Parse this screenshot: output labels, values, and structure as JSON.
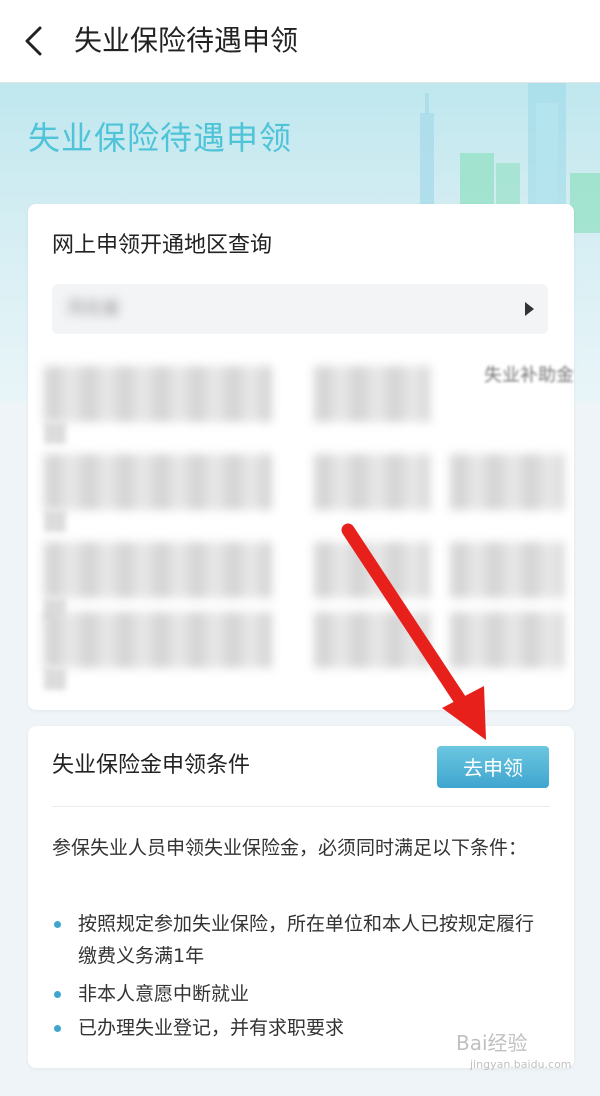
{
  "header": {
    "title": "失业保险待遇申领"
  },
  "hero": {
    "title": "失业保险待遇申领"
  },
  "region_query": {
    "heading": "网上申领开通地区查询",
    "selected_region": "河北省",
    "rows": [
      {
        "col1": "",
        "col2": "",
        "col3": "失业补助金"
      },
      {
        "col1": "",
        "col2": "",
        "col3": ""
      },
      {
        "col1": "",
        "col2": "",
        "col3": ""
      },
      {
        "col1": "",
        "col2": "",
        "col3": ""
      }
    ]
  },
  "conditions": {
    "heading": "失业保险金申领条件",
    "apply_label": "去申领",
    "intro": "参保失业人员申领失业保险金，必须同时满足以下条件：",
    "items": [
      "按照规定参加失业保险，所在单位和本人已按规定履行缴费义务满1年",
      "非本人意愿中断就业",
      "已办理失业登记，并有求职要求"
    ]
  },
  "watermark": {
    "text": "Bai经验",
    "sub": "jingyan.baidu.com"
  },
  "icons": {
    "back": "chevron-left-icon",
    "dropdown": "triangle-right-icon",
    "bullet": "dot-icon"
  },
  "colors": {
    "accent": "#3fa5cf",
    "hero_title": "#4fc3d8",
    "annotation_arrow": "#e8201c"
  }
}
